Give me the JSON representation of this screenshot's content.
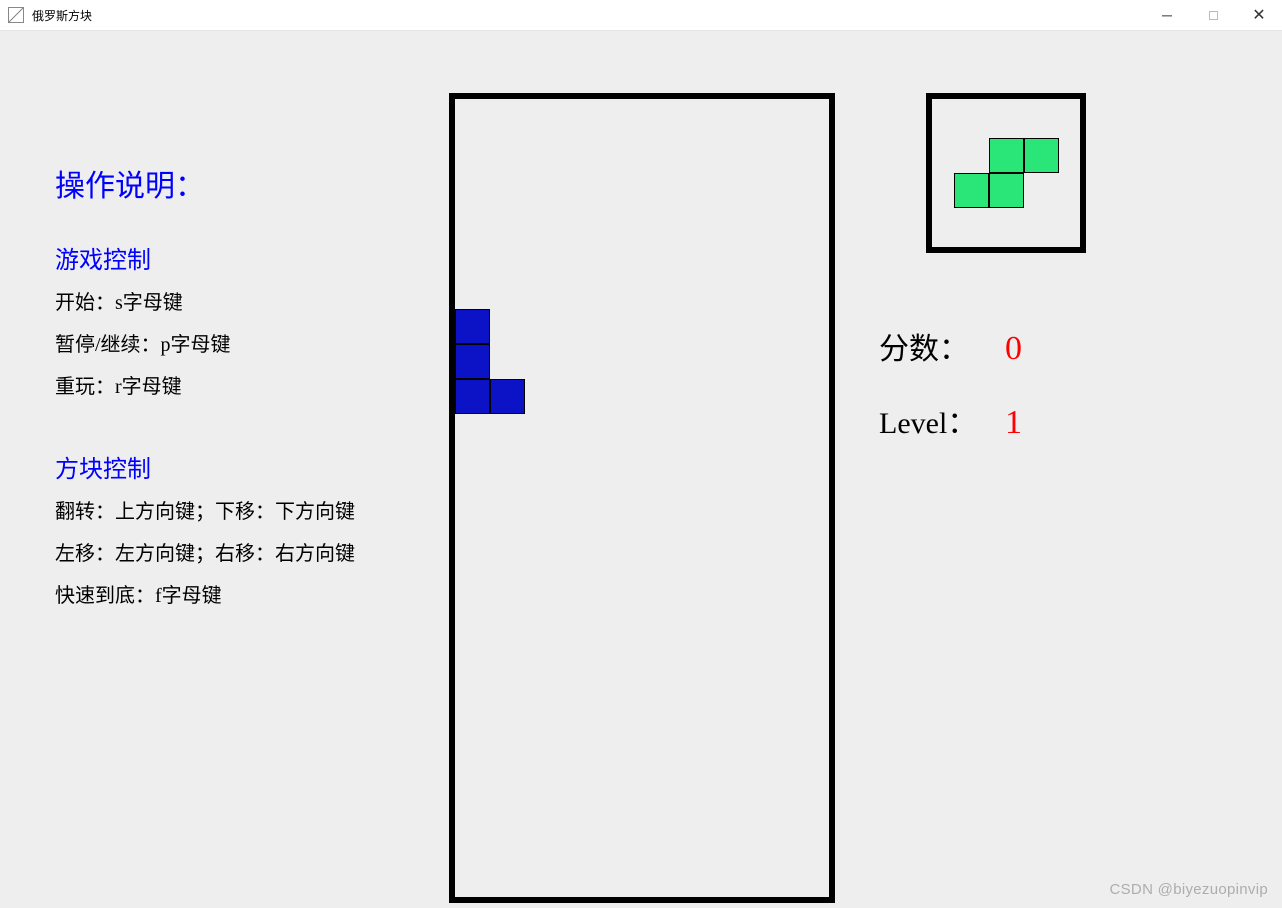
{
  "window": {
    "title": "俄罗斯方块"
  },
  "instructions": {
    "title": "操作说明：",
    "game_control_title": "游戏控制",
    "start_line": "开始：s字母键",
    "pause_line": "暂停/继续：p字母键",
    "replay_line": "重玩：r字母键",
    "block_control_title": "方块控制",
    "rotate_line": "翻转：上方向键；下移：下方向键",
    "move_line": "左移：左方向键；右移：右方向键",
    "drop_line": "快速到底：f字母键"
  },
  "game": {
    "board": {
      "cols": 10,
      "rows": 20,
      "cell_size": 35,
      "current_piece": {
        "type": "J",
        "color": "blue",
        "cells": [
          [
            0,
            6
          ],
          [
            0,
            7
          ],
          [
            0,
            8
          ],
          [
            1,
            8
          ]
        ]
      }
    },
    "preview": {
      "next_piece": {
        "type": "S",
        "color": "green",
        "cells": [
          [
            1,
            0
          ],
          [
            2,
            0
          ],
          [
            0,
            1
          ],
          [
            1,
            1
          ]
        ]
      }
    }
  },
  "stats": {
    "score_label": "分数：",
    "score_value": "0",
    "level_label": "Level：",
    "level_value": "1"
  },
  "watermark": "CSDN @biyezuopinvip"
}
